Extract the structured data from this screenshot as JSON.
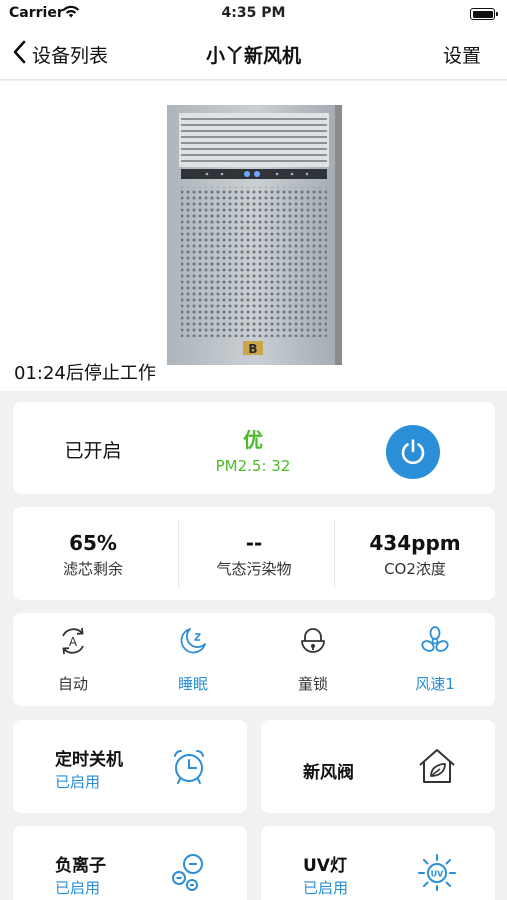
{
  "status_bar": {
    "carrier": "Carrier",
    "time": "4:35 PM"
  },
  "nav": {
    "back_label": "设备列表",
    "title": "小丫新风机",
    "settings_label": "设置"
  },
  "hero": {
    "timer_text": "01:24后停止工作"
  },
  "power_card": {
    "state": "已开启",
    "aq_level": "优",
    "pm25": "PM2.5: 32",
    "aq_color": "#4cbb2b",
    "button_color": "#2a8fd7"
  },
  "stats": [
    {
      "value": "65%",
      "label": "滤芯剩余"
    },
    {
      "value": "--",
      "label": "气态污染物"
    },
    {
      "value": "434ppm",
      "label": "CO2浓度"
    }
  ],
  "modes": [
    {
      "label": "自动",
      "icon": "auto-mode-icon",
      "active": false
    },
    {
      "label": "睡眠",
      "icon": "sleep-moon-icon",
      "active": true
    },
    {
      "label": "童锁",
      "icon": "child-lock-icon",
      "active": false
    },
    {
      "label": "风速1",
      "icon": "fan-icon",
      "active": true
    }
  ],
  "features": {
    "timer_off": {
      "name": "定时关机",
      "status": "已启用",
      "icon": "alarm-clock-icon"
    },
    "fresh_air_valve": {
      "name": "新风阀",
      "icon": "house-leaf-icon"
    },
    "anion": {
      "name": "负离子",
      "status": "已启用",
      "icon": "negative-ion-icon"
    },
    "uv_lamp": {
      "name": "UV灯",
      "status": "已启用",
      "icon": "uv-lamp-icon"
    }
  },
  "colors": {
    "accent": "#2a8fd7",
    "good": "#4cbb2b",
    "background": "#f1f1f3"
  }
}
